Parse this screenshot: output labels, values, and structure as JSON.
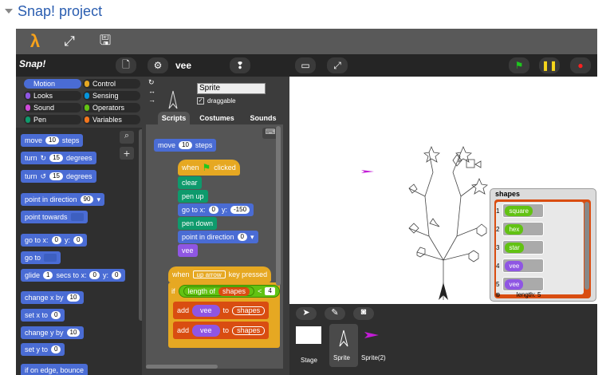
{
  "page": {
    "title": "Snap! project"
  },
  "ide": {
    "logo": "Snap!",
    "project_name": "vee",
    "icons": [
      "lambda-icon",
      "fullscreen-icon",
      "save-icon",
      "file-icon",
      "gear-icon",
      "cloud-icon",
      "stage-size-icon",
      "presentation-icon",
      "green-flag-icon",
      "pause-icon",
      "stop-icon"
    ]
  },
  "categories": [
    {
      "label": "Motion",
      "color": "#4a6cd4"
    },
    {
      "label": "Control",
      "color": "#e6a822"
    },
    {
      "label": "Looks",
      "color": "#8f56e3"
    },
    {
      "label": "Sensing",
      "color": "#0494dc"
    },
    {
      "label": "Sound",
      "color": "#cf4ad9"
    },
    {
      "label": "Operators",
      "color": "#62c213"
    },
    {
      "label": "Pen",
      "color": "#0e9a6c"
    },
    {
      "label": "Variables",
      "color": "#f3761d"
    }
  ],
  "palette": {
    "move": {
      "a": "move",
      "v": "10",
      "b": "steps"
    },
    "turn_cw": {
      "a": "turn",
      "v": "15",
      "b": "degrees"
    },
    "turn_ccw": {
      "a": "turn",
      "v": "15",
      "b": "degrees"
    },
    "point_dir": {
      "a": "point in direction",
      "v": "90"
    },
    "point_towards": {
      "a": "point towards"
    },
    "goto_xy": {
      "a": "go to x:",
      "v1": "0",
      "b": "y:",
      "v2": "0"
    },
    "goto": {
      "a": "go to"
    },
    "glide": {
      "a": "glide",
      "v1": "1",
      "b": "secs to x:",
      "v2": "0",
      "c": "y:",
      "v3": "0"
    },
    "change_x": {
      "a": "change x by",
      "v": "10"
    },
    "set_x": {
      "a": "set x to",
      "v": "0"
    },
    "change_y": {
      "a": "change y by",
      "v": "10"
    },
    "set_y": {
      "a": "set y to",
      "v": "0"
    },
    "bounce": "if on edge, bounce"
  },
  "sprite": {
    "name": "Sprite",
    "draggable": "draggable"
  },
  "tabs": {
    "scripts": "Scripts",
    "costumes": "Costumes",
    "sounds": "Sounds"
  },
  "scripts": {
    "move": {
      "a": "move",
      "v": "10",
      "b": "steps"
    },
    "hat1": {
      "a": "when",
      "b": "clicked"
    },
    "clear": "clear",
    "penup": "pen up",
    "goto": {
      "a": "go to x:",
      "v1": "0",
      "b": "y:",
      "v2": "-150"
    },
    "pendown": "pen down",
    "pointdir": {
      "a": "point in direction",
      "v": "0"
    },
    "vee": "vee",
    "hat2": {
      "a": "when",
      "key": "up arrow",
      "b": "key pressed"
    },
    "if": {
      "a": "if",
      "b": "length of",
      "var": "shapes",
      "op": "<",
      "v": "4"
    },
    "add1": {
      "a": "add",
      "item": "vee",
      "b": "to",
      "var": "shapes"
    },
    "add2": {
      "a": "add",
      "item": "vee",
      "b": "to",
      "var": "shapes"
    }
  },
  "watcher": {
    "title": "shapes",
    "items": [
      {
        "index": "1",
        "label": "square"
      },
      {
        "index": "2",
        "label": "hex"
      },
      {
        "index": "3",
        "label": "star"
      },
      {
        "index": "4",
        "label": "vee"
      },
      {
        "index": "5",
        "label": "vee"
      }
    ],
    "length_label": "length: 5"
  },
  "corral": {
    "stage": "Stage",
    "sprites": [
      "Sprite",
      "Sprite(2)"
    ]
  }
}
